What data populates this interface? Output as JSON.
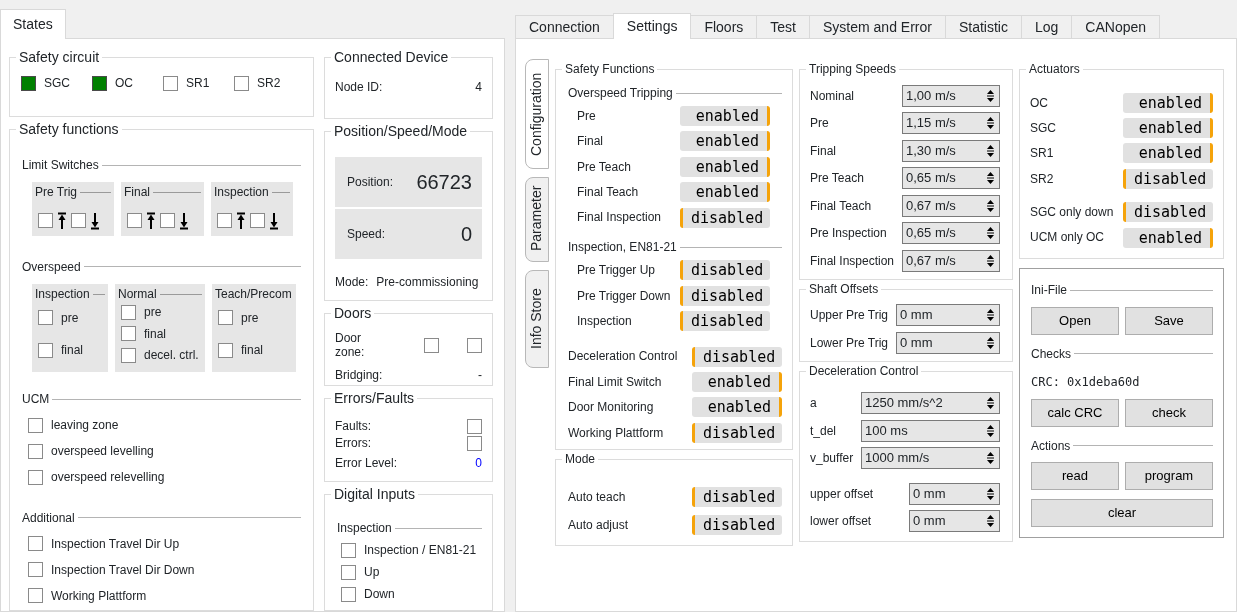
{
  "left_tabs": [
    {
      "label": "States",
      "selected": true
    }
  ],
  "safety_circuit": {
    "title": "Safety circuit",
    "items": [
      {
        "label": "SGC",
        "checked": true
      },
      {
        "label": "OC",
        "checked": true
      },
      {
        "label": "SR1",
        "checked": false
      },
      {
        "label": "SR2",
        "checked": false
      }
    ]
  },
  "safety_functions": {
    "title": "Safety functions",
    "limit_switches": {
      "title": "Limit Switches",
      "groups": [
        {
          "title": "Pre Trig",
          "up_checked": false,
          "down_checked": false
        },
        {
          "title": "Final",
          "up_checked": false,
          "down_checked": false
        },
        {
          "title": "Inspection",
          "up_checked": false,
          "down_checked": false
        }
      ]
    },
    "overspeed": {
      "title": "Overspeed",
      "groups": [
        {
          "title": "Inspection",
          "items": [
            {
              "label": "pre",
              "checked": false
            },
            {
              "label": "final",
              "checked": false
            }
          ]
        },
        {
          "title": "Normal",
          "items": [
            {
              "label": "pre",
              "checked": false
            },
            {
              "label": "final",
              "checked": false
            },
            {
              "label": "decel. ctrl.",
              "checked": false
            }
          ]
        },
        {
          "title": "Teach/Precom",
          "items": [
            {
              "label": "pre",
              "checked": false
            },
            {
              "label": "final",
              "checked": false
            }
          ]
        }
      ]
    },
    "ucm": {
      "title": "UCM",
      "items": [
        {
          "label": "leaving zone",
          "checked": false
        },
        {
          "label": "overspeed levelling",
          "checked": false
        },
        {
          "label": "overspeed relevelling",
          "checked": false
        }
      ]
    },
    "additional": {
      "title": "Additional",
      "items": [
        {
          "label": "Inspection Travel Dir Up",
          "checked": false
        },
        {
          "label": "Inspection Travel Dir Down",
          "checked": false
        },
        {
          "label": "Working Plattform",
          "checked": false
        }
      ]
    }
  },
  "connected_device": {
    "title": "Connected Device",
    "label": "Node ID:",
    "value": "4"
  },
  "position_speed_mode": {
    "title": "Position/Speed/Mode",
    "readouts": [
      {
        "label": "Position:",
        "value": "66723"
      },
      {
        "label": "Speed:",
        "value": "0"
      }
    ],
    "mode_label": "Mode:",
    "mode_value": "Pre-commissioning"
  },
  "doors": {
    "title": "Doors",
    "door_zone_label": "Door zone:",
    "door_zone": [
      {
        "checked": false
      },
      {
        "checked": false
      }
    ],
    "bridging_label": "Bridging:",
    "bridging_value": "-"
  },
  "errors_faults": {
    "title": "Errors/Faults",
    "faults_label": "Faults:",
    "faults_checked": false,
    "errors_label": "Errors:",
    "errors_checked": false,
    "error_level_label": "Error Level:",
    "error_level": "0"
  },
  "digital_inputs": {
    "title": "Digital Inputs",
    "group_title": "Inspection",
    "items": [
      {
        "label": "Inspection / EN81-21",
        "checked": false
      },
      {
        "label": "Up",
        "checked": false
      },
      {
        "label": "Down",
        "checked": false
      }
    ]
  },
  "main_tabs": [
    {
      "label": "Connection",
      "selected": false
    },
    {
      "label": "Settings",
      "selected": true
    },
    {
      "label": "Floors",
      "selected": false
    },
    {
      "label": "Test",
      "selected": false
    },
    {
      "label": "System and Error",
      "selected": false
    },
    {
      "label": "Statistic",
      "selected": false
    },
    {
      "label": "Log",
      "selected": false
    },
    {
      "label": "CANopen",
      "selected": false
    }
  ],
  "side_tabs": [
    {
      "label": "Configuration",
      "selected": true
    },
    {
      "label": "Parameter",
      "selected": false
    },
    {
      "label": "Info Store",
      "selected": false
    }
  ],
  "safety_config": {
    "title": "Safety Functions",
    "sections": [
      {
        "title": "Overspeed Tripping",
        "rows": [
          {
            "label": "Pre",
            "value": "enabled",
            "enabled": true
          },
          {
            "label": "Final",
            "value": "enabled",
            "enabled": true
          },
          {
            "label": "Pre Teach",
            "value": "enabled",
            "enabled": true
          },
          {
            "label": "Final Teach",
            "value": "enabled",
            "enabled": true
          },
          {
            "label": "Final Inspection",
            "value": "disabled",
            "enabled": false
          }
        ]
      },
      {
        "title": "Inspection, EN81-21",
        "rows": [
          {
            "label": "Pre Trigger Up",
            "value": "disabled",
            "enabled": false
          },
          {
            "label": "Pre Trigger Down",
            "value": "disabled",
            "enabled": false
          },
          {
            "label": "Inspection",
            "value": "disabled",
            "enabled": false
          }
        ]
      },
      {
        "rows": [
          {
            "label": "Deceleration Control",
            "value": "disabled",
            "enabled": false
          },
          {
            "label": "Final Limit Switch",
            "value": "enabled",
            "enabled": true
          },
          {
            "label": "Door Monitoring",
            "value": "enabled",
            "enabled": true
          },
          {
            "label": "Working Plattform",
            "value": "disabled",
            "enabled": false
          }
        ]
      }
    ]
  },
  "mode": {
    "title": "Mode",
    "rows": [
      {
        "label": "Auto teach",
        "value": "disabled",
        "enabled": false
      },
      {
        "label": "Auto adjust",
        "value": "disabled",
        "enabled": false
      }
    ]
  },
  "tripping_speeds": {
    "title": "Tripping Speeds",
    "rows": [
      {
        "label": "Nominal",
        "value": "1,00 m/s"
      },
      {
        "label": "Pre",
        "value": "1,15 m/s"
      },
      {
        "label": "Final",
        "value": "1,30 m/s"
      },
      {
        "label": "Pre Teach",
        "value": "0,65 m/s"
      },
      {
        "label": "Final Teach",
        "value": "0,67 m/s"
      },
      {
        "label": "Pre Inspection",
        "value": "0,65 m/s"
      },
      {
        "label": "Final Inspection",
        "value": "0,67 m/s"
      }
    ]
  },
  "shaft_offsets": {
    "title": "Shaft Offsets",
    "rows": [
      {
        "label": "Upper Pre Trig",
        "value": "0 mm"
      },
      {
        "label": "Lower Pre Trig",
        "value": "0 mm"
      }
    ]
  },
  "deceleration_control": {
    "title": "Deceleration Control",
    "groups": [
      {
        "rows": [
          {
            "label": "a",
            "value": "1250 mm/s^2"
          },
          {
            "label": "t_del",
            "value": "100 ms"
          },
          {
            "label": "v_buffer",
            "value": "1000 mm/s"
          }
        ]
      },
      {
        "rows": [
          {
            "label": "upper offset",
            "value": "0 mm"
          },
          {
            "label": "lower offset",
            "value": "0 mm"
          }
        ]
      }
    ]
  },
  "actuators": {
    "title": "Actuators",
    "groups": [
      {
        "rows": [
          {
            "label": "OC",
            "value": "enabled",
            "enabled": true
          },
          {
            "label": "SGC",
            "value": "enabled",
            "enabled": true
          },
          {
            "label": "SR1",
            "value": "enabled",
            "enabled": true
          },
          {
            "label": "SR2",
            "value": "disabled",
            "enabled": false
          }
        ]
      },
      {
        "rows": [
          {
            "label": "SGC only down",
            "value": "disabled",
            "enabled": false
          },
          {
            "label": "UCM only OC",
            "value": "enabled",
            "enabled": true
          }
        ]
      }
    ]
  },
  "file_panel": {
    "sections": [
      {
        "title": "Ini-File",
        "buttons": [
          "Open",
          "Save"
        ]
      },
      {
        "title": "Checks",
        "crc": "CRC: 0x1deba60d",
        "buttons": [
          "calc CRC",
          "check"
        ]
      },
      {
        "title": "Actions",
        "buttons": [
          "read",
          "program",
          "clear"
        ]
      }
    ]
  }
}
